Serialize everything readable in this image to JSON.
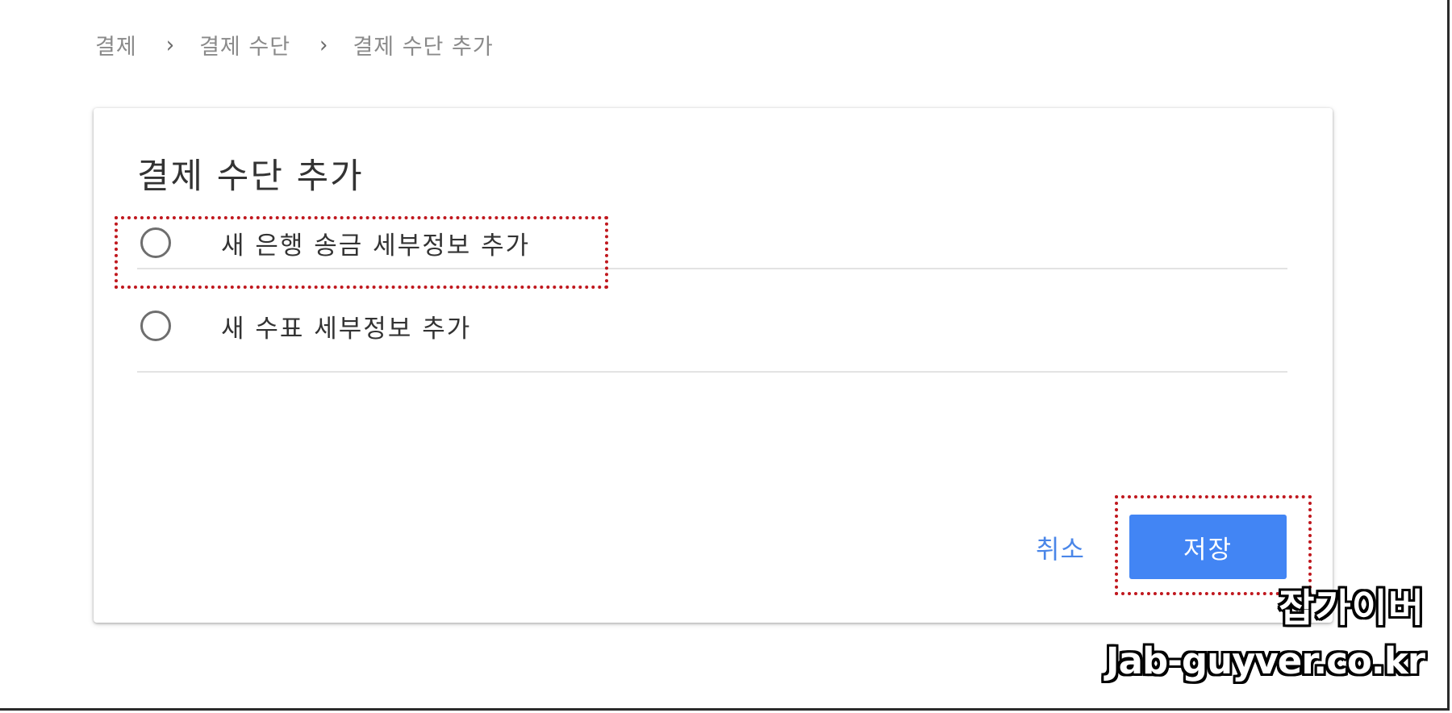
{
  "breadcrumb": {
    "items": [
      "결제",
      "결제 수단",
      "결제 수단 추가"
    ],
    "separator": "›"
  },
  "dialog": {
    "title": "결제 수단 추가",
    "options": [
      {
        "label": "새 은행 송금 세부정보 추가",
        "selected": false,
        "highlighted": true
      },
      {
        "label": "새 수표 세부정보 추가",
        "selected": false,
        "highlighted": false
      }
    ],
    "cancel_label": "취소",
    "save_label": "저장"
  },
  "watermark": {
    "korean": "잡가이버",
    "domain": "Jab-guyver.co.kr"
  },
  "colors": {
    "accent": "#4285f4",
    "link": "#4a86e8",
    "highlight_border": "#c0181e",
    "breadcrumb_text": "#8a8a8a"
  },
  "icons": [
    "chevron-right-icon",
    "radio-unchecked-icon"
  ]
}
